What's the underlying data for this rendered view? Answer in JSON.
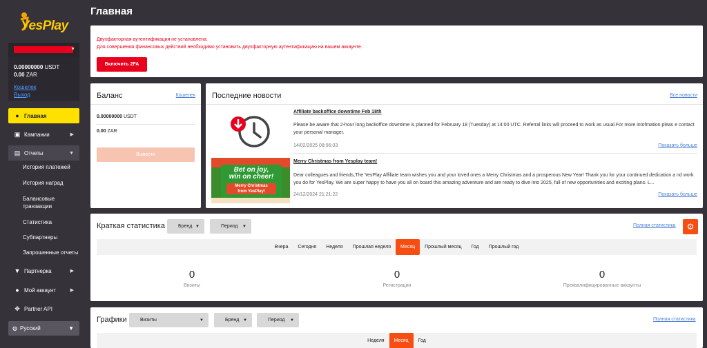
{
  "brand": {
    "logo_text": "YesPlay"
  },
  "sidebar": {
    "balance_usdt": "0.00000000",
    "currency_usdt": "USDT",
    "balance_zar": "0.00",
    "currency_zar": "ZAR",
    "wallet_link": "Кошелек",
    "logout_link": "Выход",
    "nav": {
      "home": "Главная",
      "campaigns": "Кампании",
      "reports": "Отчеты",
      "partner": "Партнерка",
      "account": "Мой аккаунт",
      "api": "Partner API"
    },
    "report_items": [
      "История платежей",
      "История наград",
      "Балансовые",
      "транзакции",
      "Статистика",
      "Субпартнеры",
      "Запрошенные отчеты"
    ],
    "language": "Русский"
  },
  "page": {
    "title": "Главная"
  },
  "twofa": {
    "warning_line1": "Двухфакторная аутентификация не установлена.",
    "warning_line2": "Для совершения финансовых действий необходимо установить двухфакторную аутентификацию на вашем аккаунте.",
    "button": "Включить 2FA"
  },
  "balance_card": {
    "title": "Баланс",
    "link": "Кошелек",
    "usdt_value": "0.00000000",
    "usdt_cur": "USDT",
    "zar_value": "0.00",
    "zar_cur": "ZAR",
    "withdraw": "Вывести"
  },
  "news": {
    "title": "Последние новости",
    "all_link": "Все новости",
    "items": [
      {
        "title": "Affiliate backoffice downtime Feb 18th",
        "body": "Please be aware that 2-hour long backoffice downtime is planned for February 18 (Tuesday) at 14:00 UTC. Referral links will proceed to work as usual.For more intofmation pleas e contact your personal manager.",
        "date": "14/02/2025 08:56:03",
        "more": "Показать больше"
      },
      {
        "title": "Merry Christmas from Yesplay team!",
        "body": "Dear colleagues and friends,The YesPlay Affiliate team wishes you and your loved ones a Merry Christmas and a prosperous New Year! Thank you for your continued dedication a nd work you do for YesPlay. We are super happy to have you all on board this amazing adventure and are ready to dive into 2025, full of new opportunities and exciting plans. L...",
        "date": "24/12/2024 21:21:22",
        "more": "Показать больше",
        "banner_line1": "Bet on joy,",
        "banner_line2": "win on cheer!",
        "banner_line3": "Merry Christmas",
        "banner_line4": "from YesPlay!"
      }
    ]
  },
  "stats": {
    "title": "Краткая статистика",
    "brand_dd": "Бренд",
    "period_dd": "Период",
    "full_link": "Полная статистика",
    "tabs": [
      "Вчера",
      "Сегодня",
      "Неделя",
      "Прошлая неделя",
      "Месяц",
      "Прошлый месяц",
      "Год",
      "Прошлый год"
    ],
    "active_tab": "Месяц",
    "visits_value": "0",
    "visits_label": "Визиты",
    "reg_value": "0",
    "reg_label": "Регистрации",
    "preq_value": "0",
    "preq_label": "Преквалифицированные аккаунты"
  },
  "graphs": {
    "title": "Графики",
    "metric_dd": "Визиты",
    "brand_dd": "Бренд",
    "period_dd": "Период",
    "full_link": "Полная статистика",
    "tabs": [
      "Неделя",
      "Месяц",
      "Год"
    ],
    "active_tab": "Месяц"
  },
  "colors": {
    "accent": "#f54d12",
    "danger": "#e8001c",
    "nav_active": "#ffe100",
    "sidebar": "#35323a"
  }
}
